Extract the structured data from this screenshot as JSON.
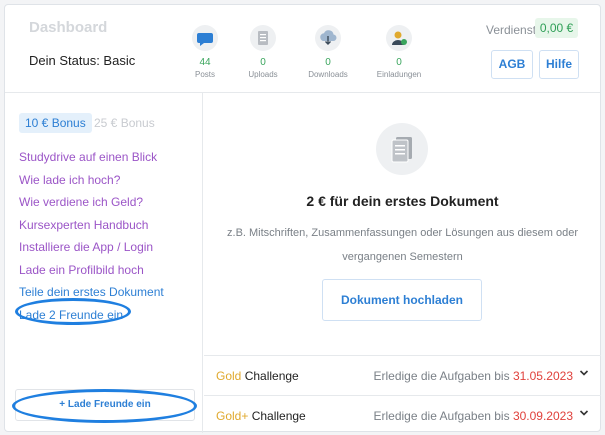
{
  "header": {
    "title": "Dashboard",
    "status": "Dein Status: Basic",
    "stats": [
      {
        "icon": "chat-bubble-icon",
        "value": "44",
        "label": "Posts"
      },
      {
        "icon": "document-icon",
        "value": "0",
        "label": "Uploads"
      },
      {
        "icon": "cloud-download-icon",
        "value": "0",
        "label": "Downloads"
      },
      {
        "icon": "user-add-icon",
        "value": "0",
        "label": "Einladungen"
      }
    ],
    "earnings_label": "Verdienst:",
    "earnings_value": "0,00 €",
    "agb_label": "AGB",
    "help_label": "Hilfe"
  },
  "sidebar": {
    "bonus_tabs": [
      "10 € Bonus",
      "25 € Bonus"
    ],
    "tasks": [
      {
        "label": "Studydrive auf einen Blick",
        "done": true
      },
      {
        "label": "Wie lade ich hoch?",
        "done": true
      },
      {
        "label": "Wie verdiene ich Geld?",
        "done": true
      },
      {
        "label": "Kursexperten Handbuch",
        "done": true
      },
      {
        "label": "Installiere die App / Login",
        "done": true
      },
      {
        "label": "Lade ein Profilbild hoch",
        "done": true
      },
      {
        "label": "Teile dein erstes Dokument",
        "done": false
      },
      {
        "label": "Lade 2 Freunde ein",
        "done": false
      }
    ],
    "invite_button": "+ Lade Freunde ein"
  },
  "main": {
    "title": "2 € für dein erstes Dokument",
    "description": "z.B. Mitschriften, Zusammenfassungen oder Lösungen aus diesem oder vergangenen Semestern",
    "upload_button": "Dokument hochladen",
    "challenges": [
      {
        "tier": "Gold",
        "suffix": " Challenge",
        "due_text": "Erledige die Aufgaben bis ",
        "date": "31.05.2023"
      },
      {
        "tier": "Gold+",
        "suffix": " Challenge",
        "due_text": "Erledige die Aufgaben bis ",
        "date": "30.09.2023"
      }
    ]
  },
  "colors": {
    "accent": "#2d7fd4",
    "done_task": "#9b55c7",
    "gold": "#e0a92e",
    "deadline": "#e0413c",
    "highlight_circle": "#1f7fe0"
  }
}
